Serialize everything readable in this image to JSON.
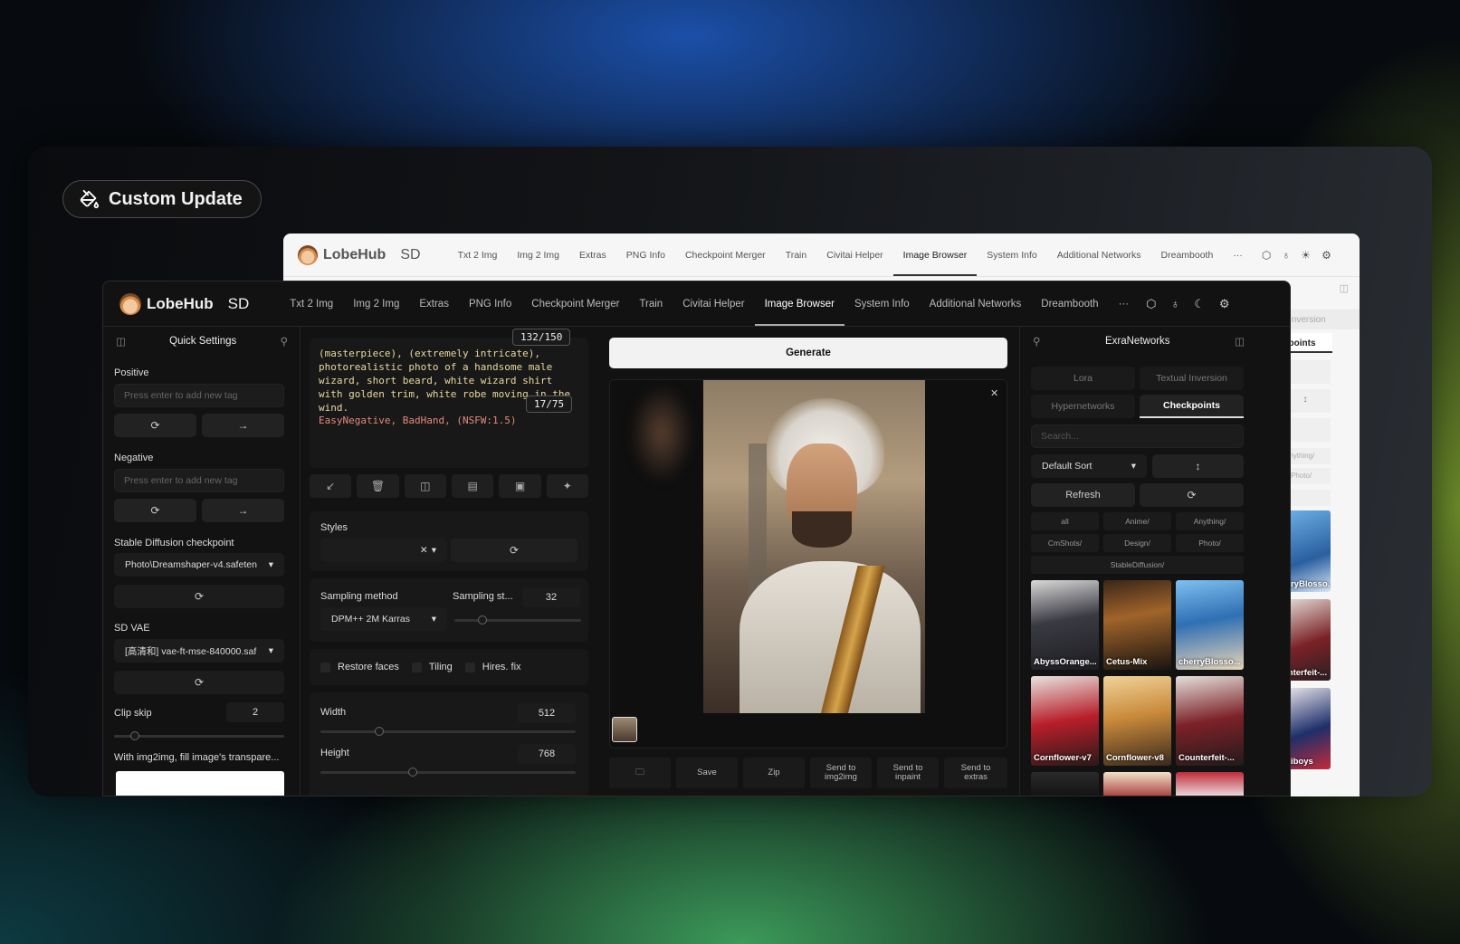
{
  "badge": {
    "label": "Custom Update",
    "icon": "paint-bucket-icon"
  },
  "back_window": {
    "brand": "LobeHub",
    "brand_suffix": "SD",
    "tabs": [
      "Txt 2 Img",
      "Img 2 Img",
      "Extras",
      "PNG Info",
      "Checkpoint Merger",
      "Train",
      "Civitai Helper",
      "Image Browser",
      "System Info",
      "Additional Networks",
      "Dreambooth",
      "···"
    ],
    "active_tab": "Image Browser",
    "side": {
      "tab1": "Inversion",
      "tab2": "kpoints",
      "chip1": "Anything/",
      "chip2": "Photo/",
      "thumb1": "erryBlosso...",
      "thumb2": "unterfeit-...",
      "thumb3": "raiboys"
    }
  },
  "front_window": {
    "brand": "LobeHub",
    "brand_suffix": "SD",
    "tabs": [
      "Txt 2 Img",
      "Img 2 Img",
      "Extras",
      "PNG Info",
      "Checkpoint Merger",
      "Train",
      "Civitai Helper",
      "Image Browser",
      "System Info",
      "Additional Networks",
      "Dreambooth",
      "···"
    ],
    "active_tab": "Image Browser"
  },
  "quick_settings": {
    "title": "Quick Settings",
    "positive_label": "Positive",
    "positive_placeholder": "Press enter to add new tag",
    "negative_label": "Negative",
    "negative_placeholder": "Press enter to add new tag",
    "checkpoint_label": "Stable Diffusion checkpoint",
    "checkpoint_value": "Photo\\Dreamshaper-v4.safeten",
    "vae_label": "SD VAE",
    "vae_value": "[高清和] vae-ft-mse-840000.saf",
    "clip_label": "Clip skip",
    "clip_value": "2",
    "clip_slider": 0.12,
    "img2img_label": "With img2img, fill image's transpare..."
  },
  "prompt": {
    "positive_text": "(masterpiece), (extremely intricate), photorealistic photo of a handsome male wizard, short beard, white wizard shirt with golden trim, white robe moving in the wind.",
    "positive_count": "132/150",
    "negative_text": "EasyNegative, BadHand, (NSFW:1.5)",
    "negative_count": "17/75"
  },
  "params": {
    "styles_label": "Styles",
    "sampling_method_label": "Sampling method",
    "sampling_method_value": "DPM++ 2M Karras",
    "sampling_steps_label": "Sampling st...",
    "sampling_steps_value": "32",
    "sampling_steps_slider": 0.22,
    "restore_faces": "Restore faces",
    "tiling": "Tiling",
    "hires_fix": "Hires. fix",
    "width_label": "Width",
    "width_value": "512",
    "width_slider": 0.23,
    "height_label": "Height",
    "height_value": "768",
    "height_slider": 0.36
  },
  "output": {
    "generate_label": "Generate",
    "actions": [
      "Save",
      "Zip",
      "Send to img2img",
      "Send to inpaint",
      "Send to extras"
    ]
  },
  "extra_networks": {
    "title": "ExraNetworks",
    "tabs": [
      "Lora",
      "Textual Inversion",
      "Hypernetworks",
      "Checkpoints"
    ],
    "active_tab": "Checkpoints",
    "search_placeholder": "Search...",
    "sort_value": "Default Sort",
    "refresh_label": "Refresh",
    "filters": [
      "all",
      "Anime/",
      "Anything/",
      "CmShots/",
      "Design/",
      "Photo/",
      "StableDiffusion/"
    ],
    "cards": [
      "AbyssOrange...",
      "Cetus-Mix",
      "cherryBlosso...",
      "Cornflower-v7",
      "Cornflower-v8",
      "Counterfeit-..."
    ]
  },
  "colors": {
    "accent": "#ffffff",
    "panel": "#121212",
    "prompt_positive": "#e8d9a0",
    "prompt_negative": "#e48a7a"
  }
}
